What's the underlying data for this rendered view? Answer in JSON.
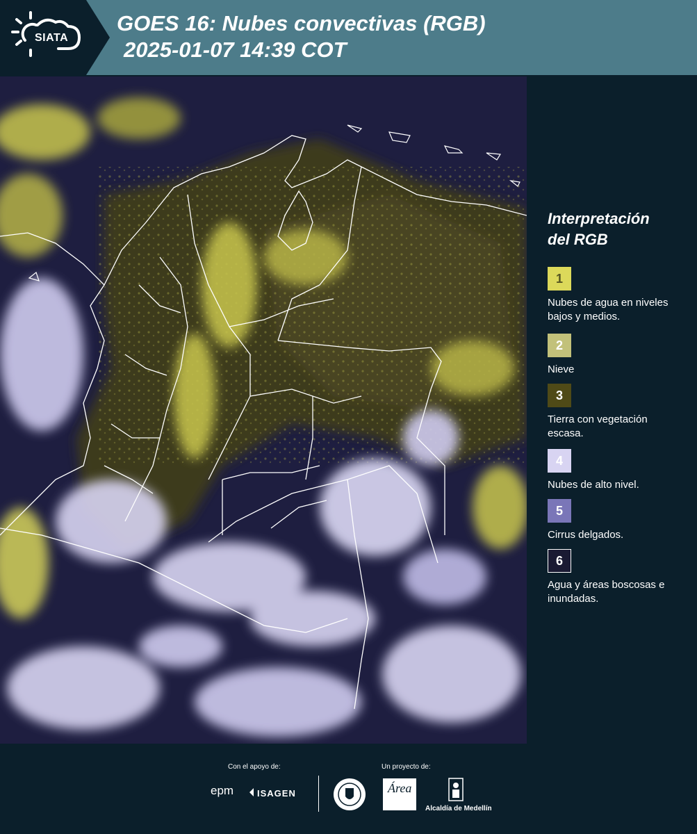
{
  "header": {
    "logo_text": "SIATA",
    "title": "GOES 16: Nubes convectivas (RGB)",
    "datetime": "2025-01-07 14:39 COT"
  },
  "legend": {
    "title_line1": "Interpretación",
    "title_line2": "del RGB",
    "items": [
      {
        "num": "1",
        "color": "#dcd95a",
        "text_color": "#555522",
        "desc": "Nubes de agua en niveles bajos y medios."
      },
      {
        "num": "2",
        "color": "#c2c17a",
        "text_color": "#ffffff",
        "desc": "Nieve"
      },
      {
        "num": "3",
        "color": "#4f4a17",
        "text_color": "#ffffff",
        "desc": "Tierra con vegetación escasa."
      },
      {
        "num": "4",
        "color": "#d8d4f2",
        "text_color": "#ffffff",
        "desc": "Nubes de alto nivel."
      },
      {
        "num": "5",
        "color": "#7a76b8",
        "text_color": "#ffffff",
        "desc": "Cirrus delgados."
      },
      {
        "num": "6",
        "color": "#1a1a33",
        "text_color": "#ffffff",
        "desc": "Agua y áreas boscosas e inundadas."
      }
    ]
  },
  "footer": {
    "support_label": "Con el apoyo de:",
    "project_label": "Un proyecto de:",
    "epm": "epm",
    "isagen": "ISAGEN",
    "area": "Área",
    "alcaldia": "Alcaldía de Medellín"
  }
}
